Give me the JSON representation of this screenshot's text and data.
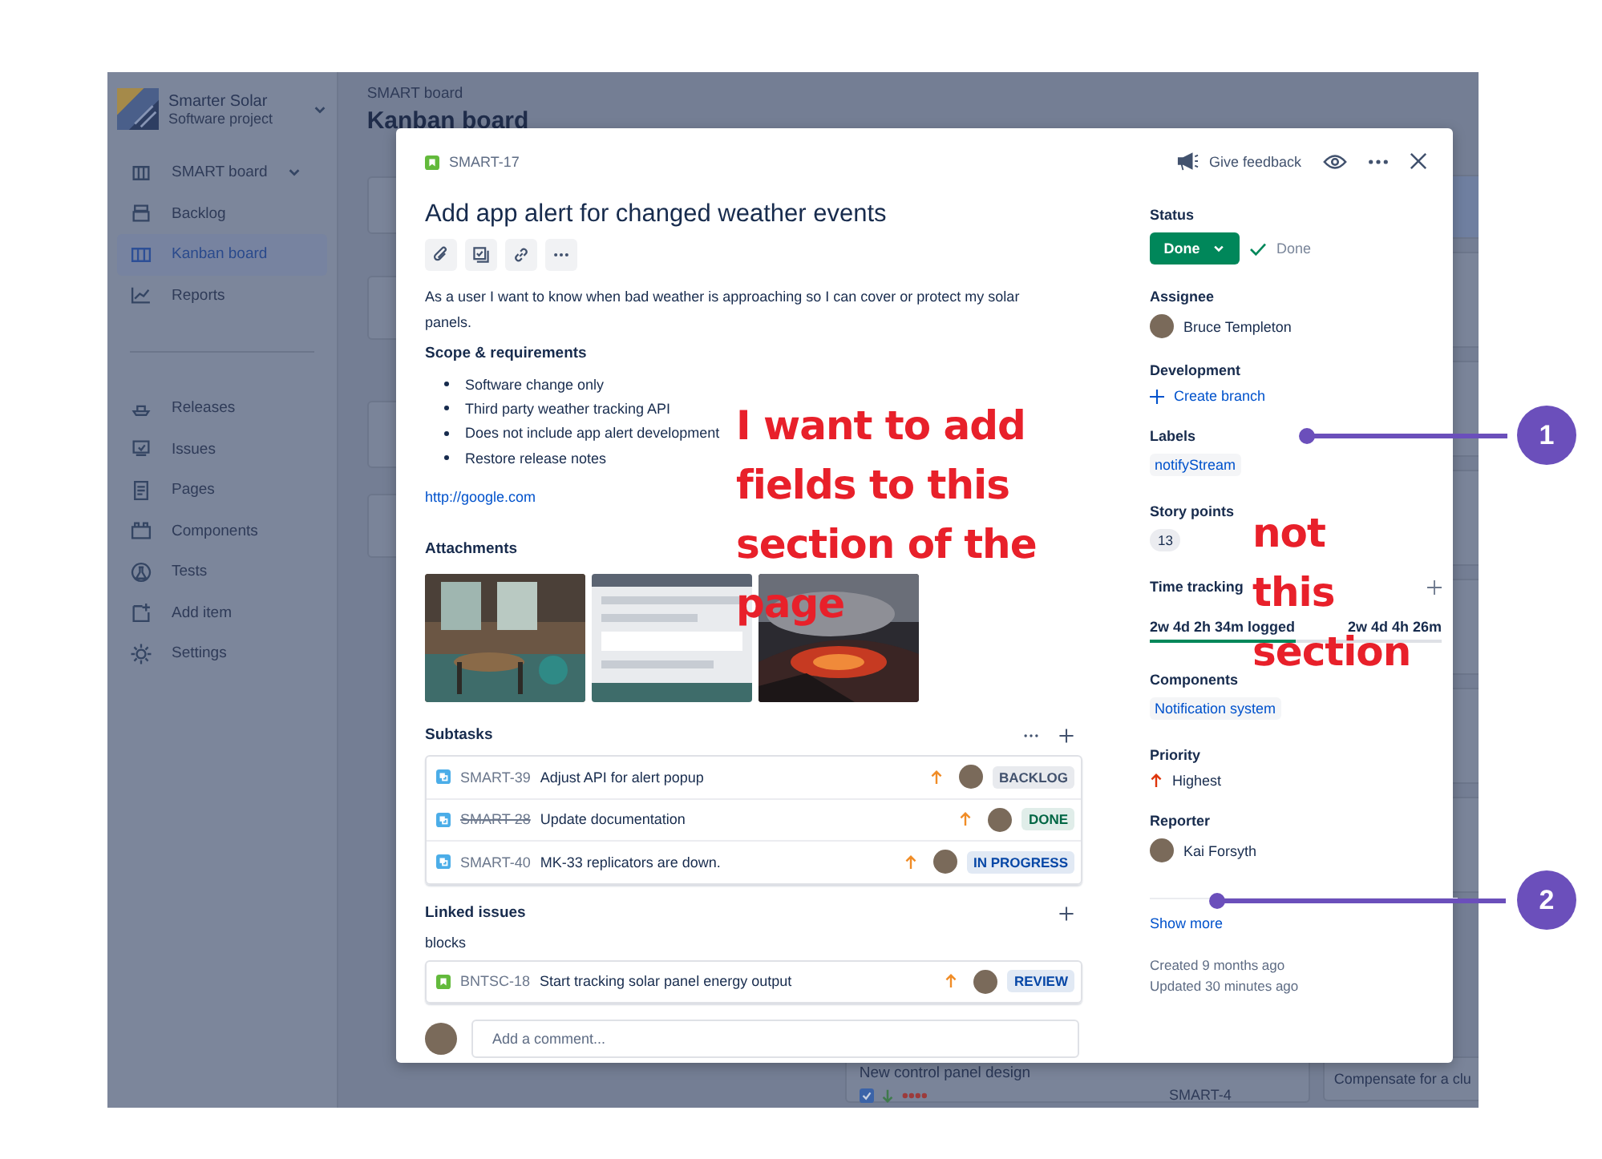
{
  "sidebar": {
    "project": {
      "name": "Smarter Solar",
      "type": "Software project"
    },
    "items": [
      {
        "label": "SMART board",
        "selected": false,
        "expandable": true
      },
      {
        "label": "Backlog",
        "selected": false,
        "expandable": false
      },
      {
        "label": "Kanban board",
        "selected": true,
        "expandable": false
      },
      {
        "label": "Reports",
        "selected": false,
        "expandable": false
      },
      {
        "label": "Releases",
        "selected": false,
        "expandable": false
      },
      {
        "label": "Issues",
        "selected": false,
        "expandable": false
      },
      {
        "label": "Pages",
        "selected": false,
        "expandable": false
      },
      {
        "label": "Components",
        "selected": false,
        "expandable": false
      },
      {
        "label": "Tests",
        "selected": false,
        "expandable": false
      },
      {
        "label": "Add item",
        "selected": false,
        "expandable": false
      },
      {
        "label": "Settings",
        "selected": false,
        "expandable": false
      }
    ]
  },
  "board": {
    "breadcrumb": "SMART board",
    "title": "Kanban board",
    "bottom_card": {
      "title": "New control panel design",
      "key": "SMART-4"
    },
    "right_card": "Compensate for a clu"
  },
  "issue": {
    "key": "SMART-17",
    "title": "Add app alert for changed weather events",
    "description": "As a user I want to know when bad weather is approaching so I can cover or protect my solar panels.",
    "scope_heading": "Scope & requirements",
    "bullets": [
      "Software change only",
      "Third party weather tracking API",
      "Does not include app alert development",
      "Restore release notes"
    ],
    "link": "http://google.com",
    "attachments_heading": "Attachments",
    "subtasks_heading": "Subtasks",
    "subtasks": [
      {
        "key": "SMART-39",
        "title": "Adjust API for alert popup",
        "done": false,
        "status": "BACKLOG",
        "color": "#42526e"
      },
      {
        "key": "SMART-28",
        "title": "Update documentation",
        "done": true,
        "status": "DONE",
        "color": "#006644"
      },
      {
        "key": "SMART-40",
        "title": "MK-33 replicators are down.",
        "done": false,
        "status": "IN PROGRESS",
        "color": "#0747a6"
      }
    ],
    "linked_heading": "Linked issues",
    "link_type": "blocks",
    "linked": [
      {
        "key": "BNTSC-18",
        "title": "Start tracking solar panel energy output",
        "done": false,
        "status": "REVIEW",
        "color": "#0747a6"
      }
    ],
    "comment_placeholder": "Add a comment...",
    "feedback": "Give feedback",
    "fields": {
      "status_label": "Status",
      "status_button": "Done",
      "resolution": "Done",
      "assignee_label": "Assignee",
      "assignee": "Bruce Templeton",
      "development_label": "Development",
      "create_branch": "Create branch",
      "labels_label": "Labels",
      "label": "notifyStream",
      "story_points_label": "Story points",
      "story_points": "13",
      "time_label": "Time tracking",
      "time_logged": "2w 4d 2h 34m logged",
      "time_remaining": "2w 4d 4h 26m",
      "level": 0.5,
      "components_label": "Components",
      "component": "Notification system",
      "priority_label": "Priority",
      "priority": "Highest",
      "reporter_label": "Reporter",
      "reporter": "Kai Forsyth",
      "show_more": "Show more",
      "created": "Created 9 months ago",
      "updated": "Updated 30 minutes ago"
    }
  },
  "annotations": {
    "notes": [
      "I want to add fields to this section of the page"
    ],
    "lines": [
      "not",
      "this",
      "section"
    ],
    "callouts": [
      "1",
      "2"
    ]
  }
}
